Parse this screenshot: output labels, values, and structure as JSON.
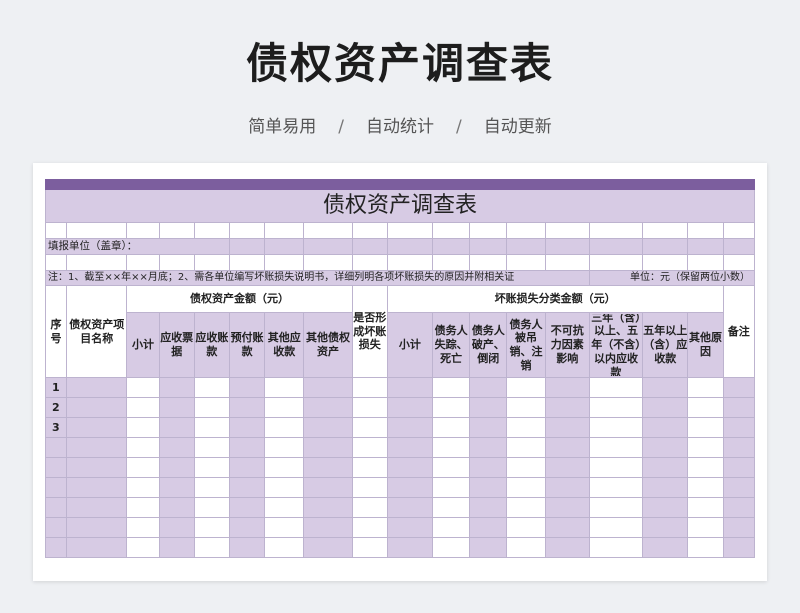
{
  "header": {
    "title": "债权资产调查表",
    "features": [
      "简单易用",
      "自动统计",
      "自动更新"
    ],
    "separator": "/"
  },
  "sheet": {
    "title": "债权资产调查表",
    "fill_unit": "填报单位（盖章）：",
    "note": "注：1、截至××年××月底；2、需各单位编写坏账损失说明书，详细列明各项坏账损失的原因并附相关证",
    "unit": "单位：元（保留两位小数）",
    "columns": {
      "seq": "序号",
      "name": "债权资产项目名称",
      "group_amount": "债权资产金额（元）",
      "is_bad": "是否形成坏账损失",
      "group_bad": "坏账损失分类金额（元）",
      "remark": "备注",
      "amount_sub": [
        "小计",
        "应收票据",
        "应收账款",
        "预付账款",
        "其他应收款",
        "其他债权资产"
      ],
      "bad_sub": [
        "小计",
        "债务人失踪、死亡",
        "债务人破产、倒闭",
        "债务人被吊销、注销",
        "不可抗力因素影响",
        "三年（含）以上、五年（不含）以内应收款",
        "五年以上（含）应收款",
        "其他原因"
      ]
    },
    "rows": [
      "1",
      "2",
      "3",
      "",
      "",
      "",
      "",
      "",
      ""
    ]
  }
}
